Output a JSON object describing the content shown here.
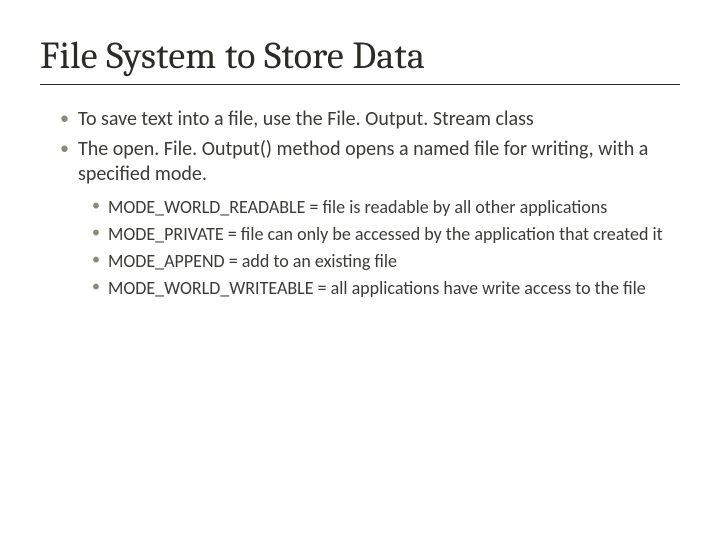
{
  "title": "File System to Store Data",
  "bullets": {
    "level1": [
      "To save text into a file, use the File. Output. Stream class",
      "The open. File. Output() method opens a named file for writing, with a specified mode."
    ],
    "level2": [
      "MODE_WORLD_READABLE = file is readable by all other applications",
      "MODE_PRIVATE = file can only be accessed by the application that created it",
      "MODE_APPEND = add to an existing file",
      "MODE_WORLD_WRITEABLE = all applications have write access to the file"
    ]
  }
}
